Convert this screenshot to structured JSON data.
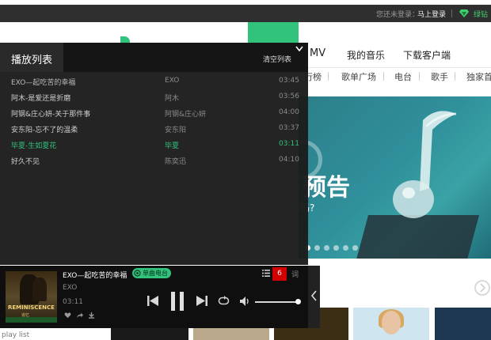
{
  "topbar": {
    "login_status": "您还未登录：",
    "login_link": "马上登录",
    "diamond": "绿钻",
    "diamond_color": "#3fd16e"
  },
  "nav": {
    "items": [
      "MV",
      "我的音乐",
      "下载客户端"
    ]
  },
  "subnav": {
    "items": [
      "行榜",
      "歌单广场",
      "电台",
      "歌手",
      "独家首"
    ]
  },
  "banner": {
    "headline": "预告",
    "subline": "吗?",
    "dots": 6,
    "active_dot": 0
  },
  "playlist": {
    "title": "播放列表",
    "clear_label": "清空列表",
    "tracks": [
      {
        "title": "EXO—起吃苦的幸福",
        "artist": "EXO",
        "time": "03:45"
      },
      {
        "title": "阿木-是爱还是折磨",
        "artist": "阿木",
        "time": "03:56"
      },
      {
        "title": "阿钢&庄心妍-关于那件事",
        "artist": "阿钢&庄心妍",
        "time": "04:00"
      },
      {
        "title": "安东阳-忘不了的温柔",
        "artist": "安东阳",
        "time": "03:37"
      },
      {
        "title": "毕夏-生如夏花",
        "artist": "毕夏",
        "time": "03:11"
      },
      {
        "title": "好久不见",
        "artist": "陈奕迅",
        "time": "04:10"
      }
    ],
    "current_index": 4
  },
  "player": {
    "title": "EXO—起吃苦的幸福",
    "radio_label": "单曲电台",
    "artist": "EXO",
    "time": "03:11",
    "queue_count": "6",
    "lyric_label": "词",
    "volume": 1.0,
    "cover_title": "REMINISCENCE",
    "cover_sub": "追忆"
  },
  "caption": "play list",
  "colors": {
    "accent": "#31c27c",
    "panel_bg": "#1c1c1c",
    "badge": "#d40000"
  }
}
